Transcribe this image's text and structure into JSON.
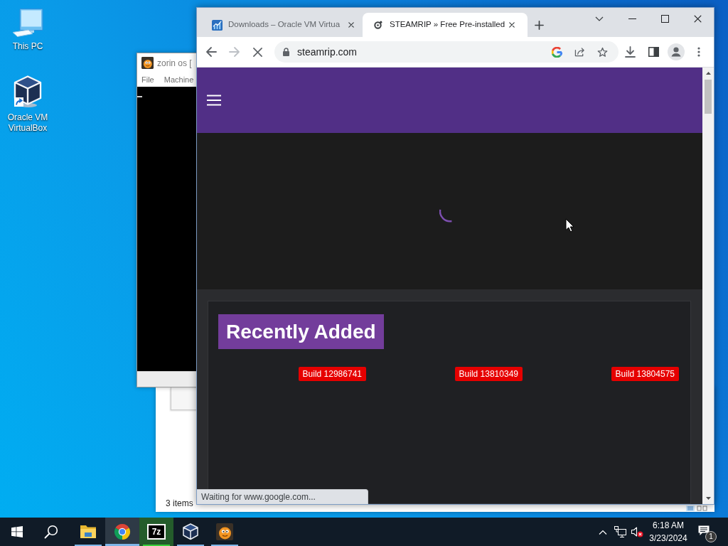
{
  "desktop_icons": [
    {
      "kind": "computer",
      "label": "This PC"
    },
    {
      "kind": "virtualbox",
      "label": "Oracle VM VirtualBox"
    }
  ],
  "vm_window": {
    "title": "zorin os [",
    "menu": [
      "File",
      "Machine"
    ]
  },
  "explorer_window": {
    "status": "3 items"
  },
  "browser": {
    "tabs": [
      {
        "kind": "chart",
        "title": "Downloads – Oracle VM Virtua",
        "selected": false
      },
      {
        "kind": "round",
        "title": "STEAMRIP » Free Pre-installed",
        "selected": true
      }
    ],
    "address": "steamrip.com",
    "loading": true,
    "page": {
      "heading": "Recently Added",
      "badges": [
        "Build 12986741",
        "Build 13810349",
        "Build 13804575"
      ]
    },
    "status_text": "Waiting for www.google.com..."
  },
  "taskbar": {
    "apps": [
      {
        "kind": "files",
        "running": true,
        "selected": false
      },
      {
        "kind": "browser",
        "running": true,
        "selected": true
      },
      {
        "kind": "archiver",
        "logo_text": "7z",
        "running": true,
        "selected": false,
        "level": 1
      },
      {
        "kind": "virtualbox",
        "running": true,
        "selected": false
      },
      {
        "kind": "vm",
        "running": true,
        "selected": false
      }
    ],
    "tray": {
      "muted": true,
      "time": "6:18 AM",
      "date": "3/23/2024",
      "notifications": "1"
    }
  }
}
